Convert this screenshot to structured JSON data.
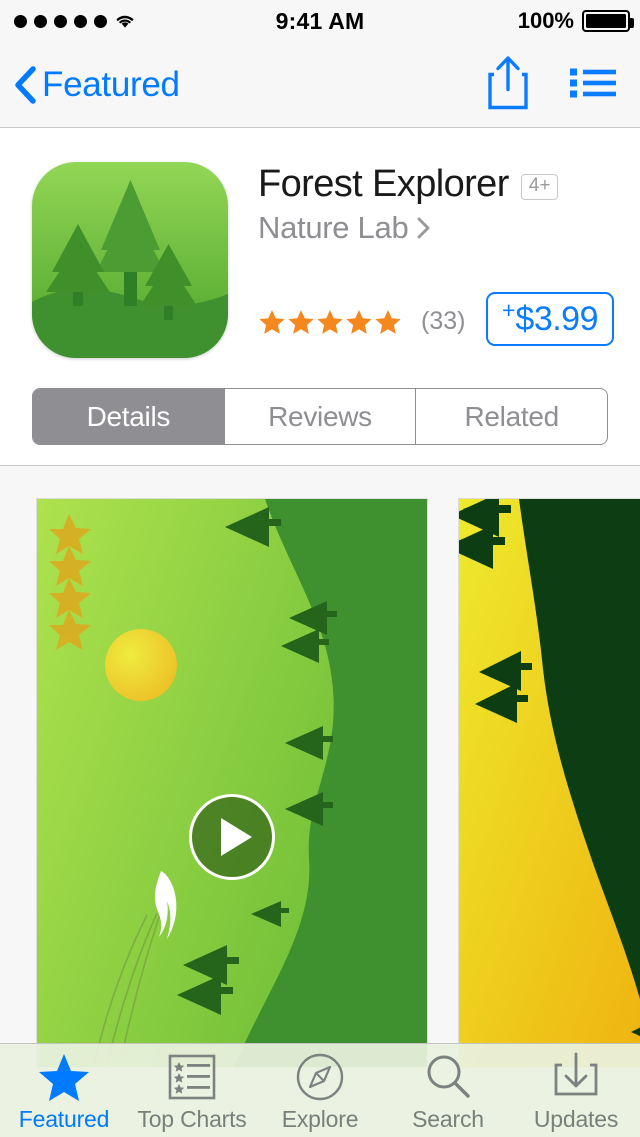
{
  "status_bar": {
    "signal_dots": 5,
    "wifi_icon": "wifi-icon",
    "time": "9:41 AM",
    "battery_percent": "100%",
    "battery_icon": "battery-full-icon"
  },
  "nav_bar": {
    "back_icon": "chevron-left-icon",
    "back_label": "Featured",
    "share_icon": "share-icon",
    "wishlist_icon": "list-icon"
  },
  "app": {
    "icon": "forest-app-icon",
    "title": "Forest Explorer",
    "age_rating": "4+",
    "developer": "Nature Lab",
    "developer_chevron_icon": "chevron-right-icon",
    "rating_stars": 5,
    "rating_max": 5,
    "review_count": "(33)",
    "price_plus": "+",
    "price": "$3.99"
  },
  "tabs": {
    "items": [
      {
        "label": "Details",
        "active": true
      },
      {
        "label": "Reviews",
        "active": false
      },
      {
        "label": "Related",
        "active": false
      }
    ]
  },
  "screenshots": {
    "items": [
      {
        "name": "screenshot-1",
        "has_play_button": true,
        "play_icon": "play-icon",
        "collected_stars": 4,
        "sky_gradient_from": "#a8e04a",
        "sky_gradient_to": "#52a82e",
        "forest_color": "#3f9130",
        "sun_color": "#f2d93c"
      },
      {
        "name": "screenshot-2",
        "has_play_button": false,
        "collected_stars": 0,
        "sky_gradient_from": "#ecea2e",
        "sky_gradient_to": "#efb310",
        "forest_color": "#0d3d12"
      }
    ]
  },
  "tab_bar": {
    "items": [
      {
        "label": "Featured",
        "icon": "star-icon",
        "active": true
      },
      {
        "label": "Top Charts",
        "icon": "top-charts-icon",
        "active": false
      },
      {
        "label": "Explore",
        "icon": "compass-icon",
        "active": false
      },
      {
        "label": "Search",
        "icon": "search-icon",
        "active": false
      },
      {
        "label": "Updates",
        "icon": "download-icon",
        "active": false
      }
    ]
  },
  "colors": {
    "accent_blue": "#007aff",
    "price_blue": "#0a7cff",
    "star_orange": "#f5871f",
    "secondary_gray": "#8e8e93",
    "bar_background": "#f7f7f7"
  }
}
